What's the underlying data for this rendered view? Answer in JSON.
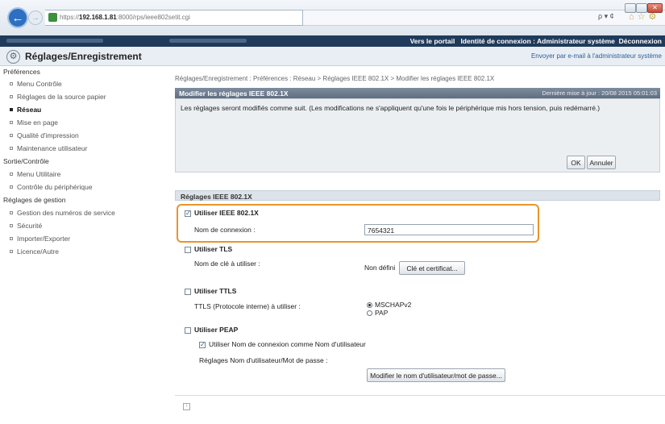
{
  "browser": {
    "url_prefix": "https://",
    "url_host": "192.168.1.81",
    "url_rest": ":8000/rps/ieee802setit.cgi",
    "search_label": "ρ ▾ ¢",
    "close_glyph": "✕"
  },
  "topbar": {
    "portal_link": "Vers le portail",
    "login_identity": "Identité de connexion : Administrateur système",
    "logout_link": "Déconnexion"
  },
  "header": {
    "title": "Réglages/Enregistrement",
    "email_link": "Envoyer par e-mail à l'administrateur système"
  },
  "sidebar": {
    "sections": [
      {
        "title": "Préférences",
        "items": [
          "Menu Contrôle",
          "Réglages de la source papier",
          "Réseau",
          "Mise en page",
          "Qualité d'impression",
          "Maintenance utilisateur"
        ]
      },
      {
        "title": "Sortie/Contrôle",
        "items": [
          "Menu Utilitaire",
          "Contrôle du périphérique"
        ]
      },
      {
        "title": "Réglages de gestion",
        "items": [
          "Gestion des numéros de service",
          "Sécurité",
          "Importer/Exporter",
          "Licence/Autre"
        ]
      }
    ],
    "active_item": "Réseau"
  },
  "breadcrumb": "Réglages/Enregistrement : Préférences : Réseau > Réglages IEEE 802.1X > Modifier les réglages IEEE 802.1X",
  "panel": {
    "title": "Modifier les réglages IEEE 802.1X",
    "last_update": "Dernière mise à jour : 20/08 2015 05:01:03",
    "info": "Les réglages seront modifiés comme suit. (Les modifications ne s'appliquent qu'une fois le périphérique mis hors tension, puis redémarré.)",
    "ok_label": "OK",
    "cancel_label": "Annuler"
  },
  "section": {
    "title": "Réglages IEEE 802.1X",
    "use_ieee_label": "Utiliser IEEE 802.1X",
    "use_ieee_checked": true,
    "login_name_label": "Nom de connexion :",
    "login_name_value": "7654321",
    "use_tls_label": "Utiliser TLS",
    "use_tls_checked": false,
    "key_label": "Nom de clé à utiliser :",
    "key_value": "Non défini",
    "key_button": "Clé et certificat...",
    "use_ttls_label": "Utiliser TTLS",
    "use_ttls_checked": false,
    "ttls_protocol_label": "TTLS (Protocole interne) à utiliser :",
    "ttls_options": [
      "MSCHAPv2",
      "PAP"
    ],
    "ttls_selected": "MSCHAPv2",
    "use_peap_label": "Utiliser PEAP",
    "use_peap_checked": false,
    "use_login_as_user_label": "Utiliser Nom de connexion comme Nom d'utilisateur",
    "use_login_as_user_checked": true,
    "user_pw_settings_label": "Réglages Nom d'utilisateur/Mot de passe :",
    "user_pw_button": "Modifier le nom d'utilisateur/mot de passe..."
  },
  "colors": {
    "highlight": "#e8952b",
    "topbar": "#1f3a5a",
    "panel_header": "#6b7a8c"
  }
}
